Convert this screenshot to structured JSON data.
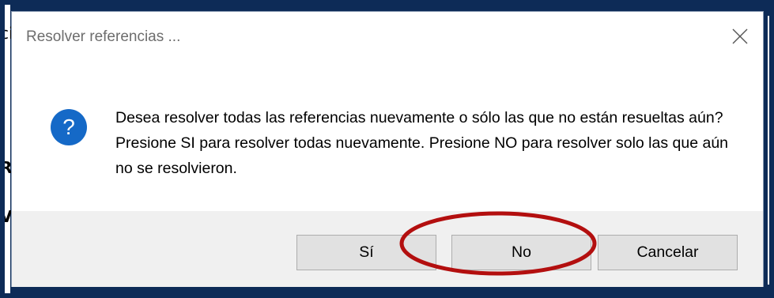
{
  "background": {
    "left_strip_chars": [
      "ci",
      "R",
      "V"
    ]
  },
  "dialog": {
    "title": "Resolver referencias ...",
    "close_icon": "close-icon",
    "message_icon": "question-icon",
    "message": "Desea resolver todas las referencias nuevamente o sólo las que no están resueltas aún? Presione SI para resolver todas nuevamente. Presione NO para resolver solo las que aún no se resolvieron.",
    "buttons": {
      "yes": "Sí",
      "no": "No",
      "cancel": "Cancelar"
    }
  },
  "annotation": {
    "highlight_target": "No",
    "highlight_color": "#b30f0f"
  },
  "colors": {
    "frame": "#0d2b57",
    "icon_blue": "#1569c7",
    "button_bar": "#f0f0f0"
  }
}
